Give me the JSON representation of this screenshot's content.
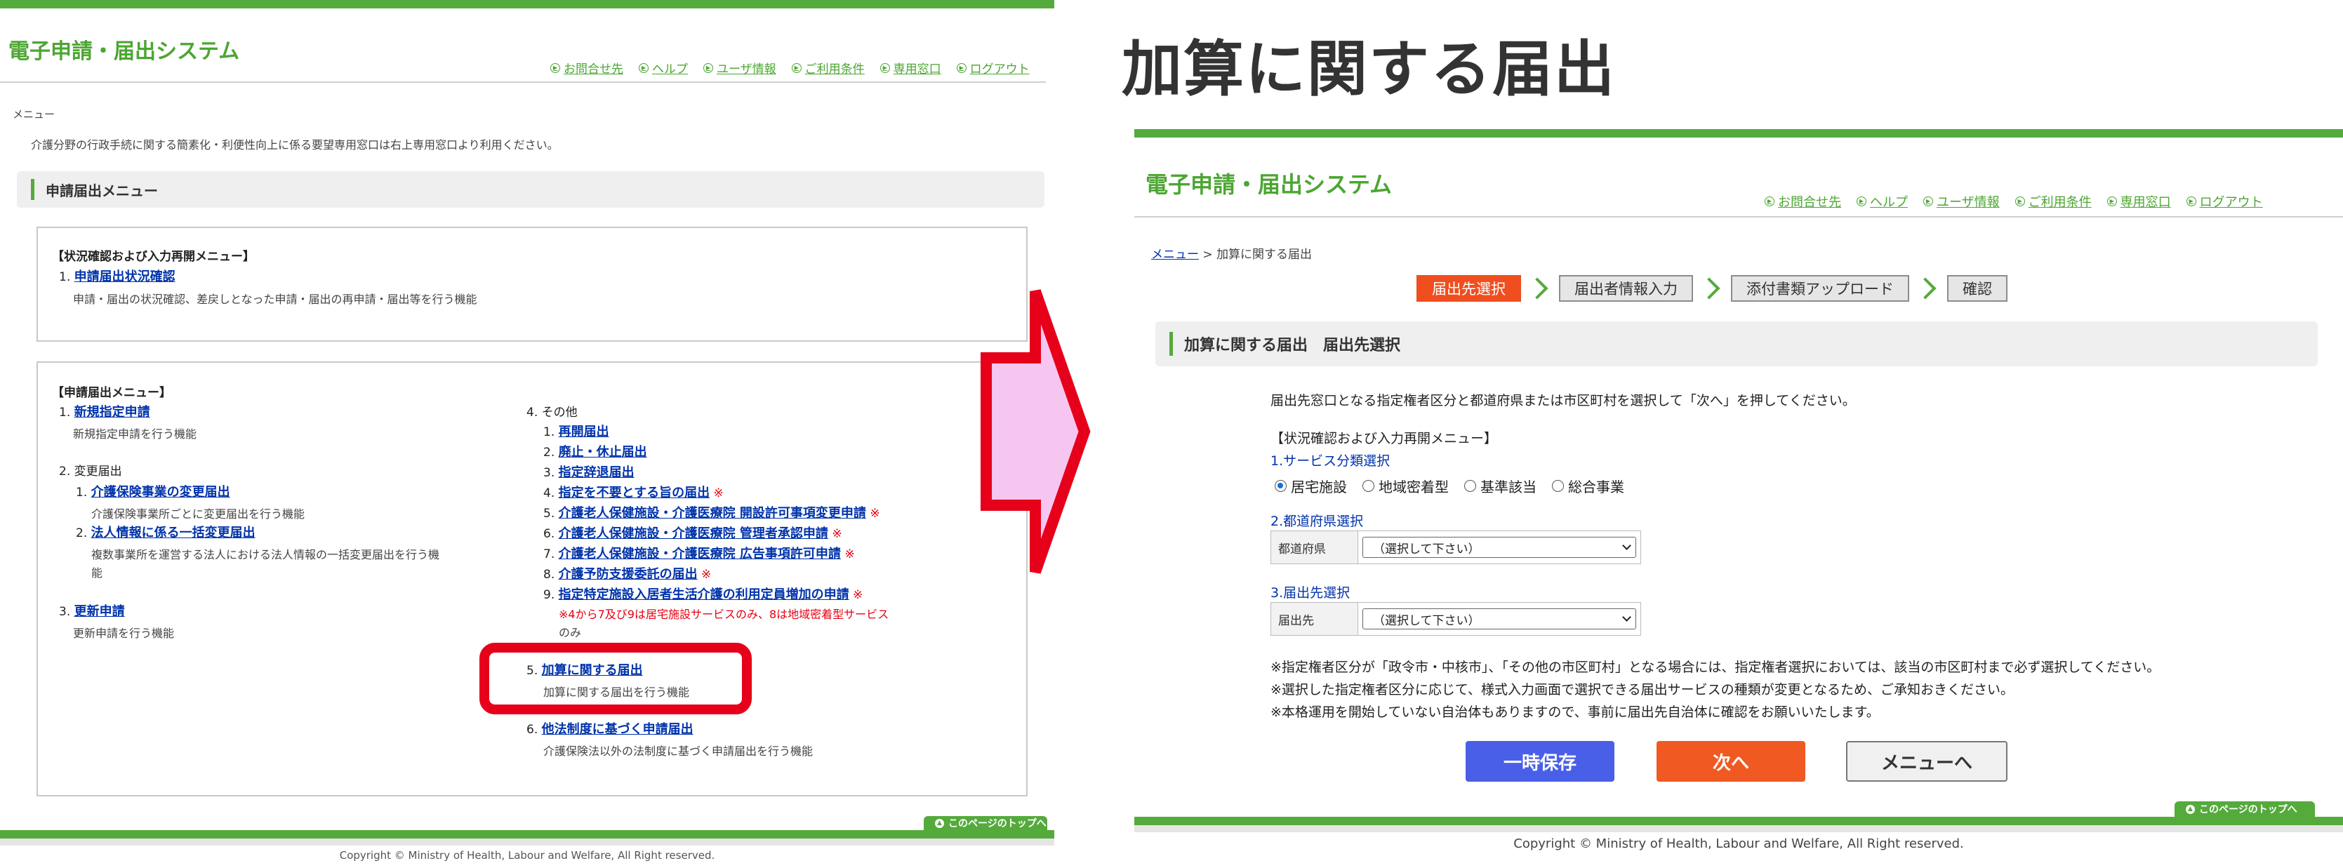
{
  "left": {
    "title": "電子申請・届出システム",
    "header_links": [
      "お問合せ先",
      "ヘルプ",
      "ユーザ情報",
      "ご利用条件",
      "専用窓口",
      "ログアウト"
    ],
    "menu_label": "メニュー",
    "notice": "介護分野の行政手続に関する簡素化・利便性向上に係る要望専用窓口は右上専用窓口より利用ください。",
    "section_title": "申請届出メニュー",
    "status_menu": {
      "heading": "【状況確認および入力再開メニュー】",
      "num": "1.",
      "link": "申請届出状況確認",
      "desc": "申請・届出の状況確認、差戻しとなった申請・届出の再申請・届出等を行う機能"
    },
    "apply_menu": {
      "heading": "【申請届出メニュー】",
      "item1": {
        "num": "1.",
        "link": "新規指定申請",
        "desc": "新規指定申請を行う機能"
      },
      "item2": {
        "title": "2. 変更届出",
        "sub1": {
          "num": "1.",
          "link": "介護保険事業の変更届出",
          "desc": "介護保険事業所ごとに変更届出を行う機能"
        },
        "sub2": {
          "num": "2.",
          "link": "法人情報に係る一括変更届出",
          "desc1": "複数事業所を運営する法人における法人情報の一括変更届出を行う機",
          "desc2": "能"
        }
      },
      "item3": {
        "num": "3.",
        "link": "更新申請",
        "desc": "更新申請を行う機能"
      },
      "item4": {
        "title": "4. その他",
        "subs": [
          {
            "num": "1.",
            "link": "再開届出",
            "mark": ""
          },
          {
            "num": "2.",
            "link": "廃止・休止届出",
            "mark": ""
          },
          {
            "num": "3.",
            "link": "指定辞退届出",
            "mark": ""
          },
          {
            "num": "4.",
            "link": "指定を不要とする旨の届出",
            "mark": "※"
          },
          {
            "num": "5.",
            "link": "介護老人保健施設・介護医療院 開設許可事項変更申請",
            "mark": "※"
          },
          {
            "num": "6.",
            "link": "介護老人保健施設・介護医療院 管理者承認申請",
            "mark": "※"
          },
          {
            "num": "7.",
            "link": "介護老人保健施設・介護医療院 広告事項許可申請",
            "mark": "※"
          },
          {
            "num": "8.",
            "link": "介護予防支援委託の届出",
            "mark": "※"
          },
          {
            "num": "9.",
            "link": "指定特定施設入居者生活介護の利用定員増加の申請",
            "mark": "※"
          }
        ],
        "note1": "※4から7及び9は居宅施設サービスのみ、8は地域密着型サービス",
        "note2": "のみ"
      },
      "item5": {
        "num": "5.",
        "link": "加算に関する届出",
        "desc": "加算に関する届出を行う機能"
      },
      "item6": {
        "num": "6.",
        "link": "他法制度に基づく申請届出",
        "desc": "介護保険法以外の法制度に基づく申請届出を行う機能"
      }
    },
    "to_top": "このページのトップへ",
    "copyright": "Copyright © Ministry of Health, Labour and Welfare, All Right reserved."
  },
  "right": {
    "heading": "加算に関する届出",
    "title": "電子申請・届出システム",
    "header_links": [
      "お問合せ先",
      "ヘルプ",
      "ユーザ情報",
      "ご利用条件",
      "専用窓口",
      "ログアウト"
    ],
    "breadcrumb": {
      "link": "メニュー",
      "sep": ">",
      "current": "加算に関する届出"
    },
    "steps": [
      "届出先選択",
      "届出者情報入力",
      "添付書類アップロード",
      "確認"
    ],
    "section_title": "加算に関する届出　届出先選択",
    "instruction": "届出先窓口となる指定権者区分と都道府県または市区町村を選択して「次へ」を押してください。",
    "status_heading": "【状況確認および入力再開メニュー】",
    "service_label": "1.サービス分類選択",
    "service_options": [
      "居宅施設",
      "地域密着型",
      "基準該当",
      "総合事業"
    ],
    "service_selected": "居宅施設",
    "pref_label": "2.都道府県選択",
    "pref_field": "都道府県",
    "pref_value": "（選択して下さい）",
    "dest_label": "3.届出先選択",
    "dest_field": "届出先",
    "dest_value": "（選択して下さい）",
    "notes": [
      "※指定権者区分が「政令市・中核市」、「その他の市区町村」となる場合には、指定権者選択においては、該当の市区町村まで必ず選択してください。",
      "※選択した指定権者区分に応じて、様式入力画面で選択できる届出サービスの種類が変更となるため、ご承知おきください。",
      "※本格運用を開始していない自治体もありますので、事前に届出先自治体に確認をお願いいたします。"
    ],
    "buttons": {
      "save": "一時保存",
      "next": "次へ",
      "menu": "メニューへ"
    },
    "to_top": "このページのトップへ",
    "copyright": "Copyright © Ministry of Health, Labour and Welfare, All Right reserved."
  },
  "colors": {
    "brand_green": "#55aa3c",
    "accent_orange": "#f04e1e",
    "link_blue": "#0033aa",
    "highlight_red": "#e6001a",
    "arrow_fill": "#f7c6f0"
  }
}
